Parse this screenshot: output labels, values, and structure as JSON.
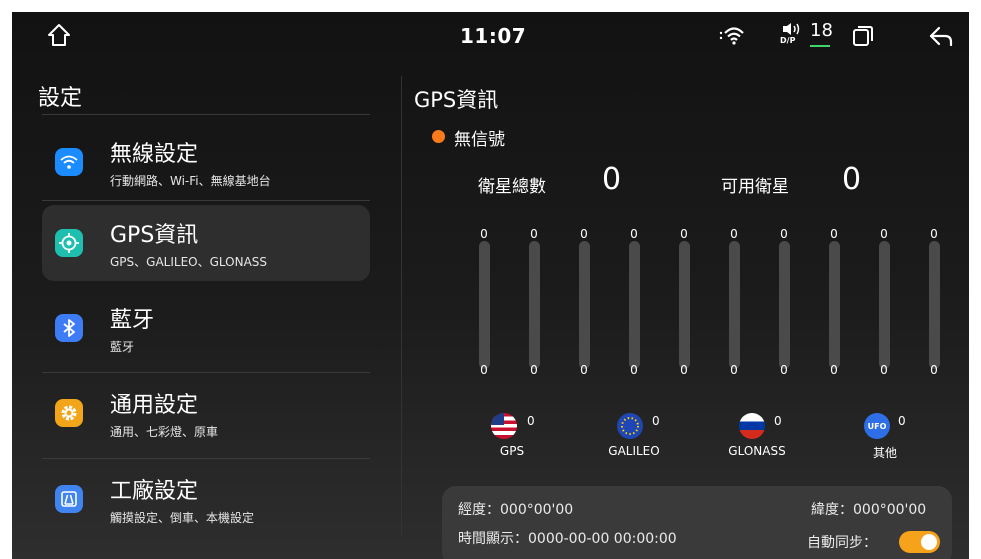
{
  "statusbar": {
    "time": "11:07",
    "dsp_label": "D/P",
    "dsp_value": "18"
  },
  "sidebar": {
    "title": "設定",
    "items": [
      {
        "label": "無線設定",
        "sub": "行動網路、Wi-Fi、無線基地台",
        "color": "#1a8cff",
        "icon": "wifi-icon"
      },
      {
        "label": "GPS資訊",
        "sub": "GPS、GALILEO、GLONASS",
        "color": "#1fbfb0",
        "icon": "location-target-icon"
      },
      {
        "label": "藍牙",
        "sub": "藍牙",
        "color": "#3d7cf4",
        "icon": "bluetooth-icon"
      },
      {
        "label": "通用設定",
        "sub": "通用、七彩燈、原車",
        "color": "#f2a518",
        "icon": "gear-icon"
      },
      {
        "label": "工廠設定",
        "sub": "觸摸設定、倒車、本機設定",
        "color": "#3f84f0",
        "icon": "factory-icon"
      }
    ]
  },
  "gps": {
    "title": "GPS資訊",
    "signal_status": "無信號",
    "signal_color": "#ff7a1a",
    "total_label": "衛星總數",
    "total_value": "0",
    "available_label": "可用衛星",
    "available_value": "0",
    "bars": [
      {
        "top": "0",
        "bottom": "0",
        "level": 0
      },
      {
        "top": "0",
        "bottom": "0",
        "level": 0
      },
      {
        "top": "0",
        "bottom": "0",
        "level": 0
      },
      {
        "top": "0",
        "bottom": "0",
        "level": 0
      },
      {
        "top": "0",
        "bottom": "0",
        "level": 0
      },
      {
        "top": "0",
        "bottom": "0",
        "level": 0
      },
      {
        "top": "0",
        "bottom": "0",
        "level": 0
      },
      {
        "top": "0",
        "bottom": "0",
        "level": 0
      },
      {
        "top": "0",
        "bottom": "0",
        "level": 0
      },
      {
        "top": "0",
        "bottom": "0",
        "level": 0
      }
    ],
    "systems": [
      {
        "name": "GPS",
        "count": "0",
        "icon": "usa-flag-icon"
      },
      {
        "name": "GALILEO",
        "count": "0",
        "icon": "eu-flag-icon"
      },
      {
        "name": "GLONASS",
        "count": "0",
        "icon": "russia-flag-icon"
      },
      {
        "name": "其他",
        "count": "0",
        "icon": "ufo-icon",
        "icon_text": "UFO"
      }
    ],
    "longitude": "經度：000°00'00",
    "latitude": "緯度：000°00'00",
    "time_display": "時間顯示：0000-00-00 00:00:00",
    "auto_sync_label": "自動同步：",
    "auto_sync_on": true,
    "toggle_color": "#f6a21a"
  }
}
